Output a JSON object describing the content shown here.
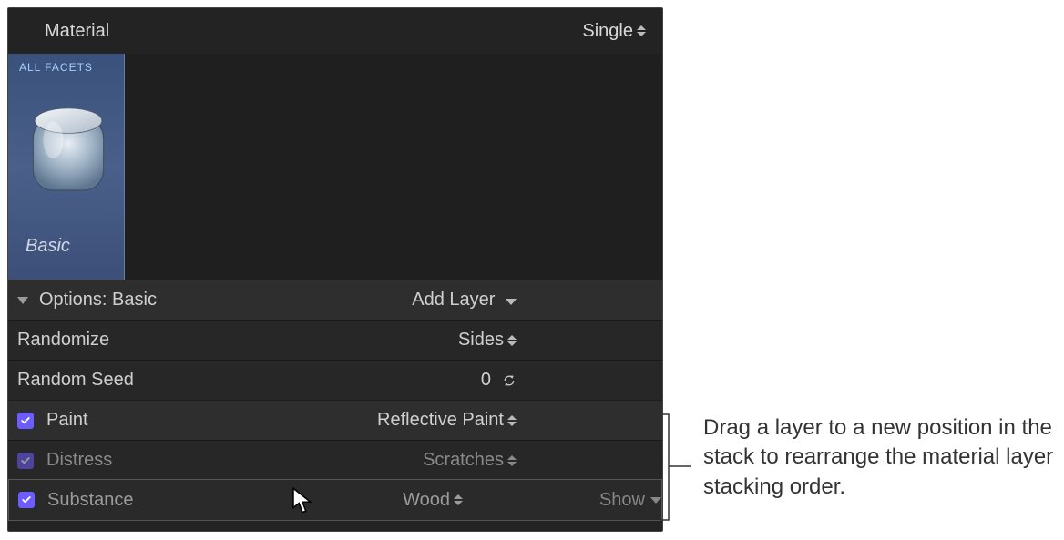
{
  "header": {
    "material_label": "Material",
    "mode_value": "Single"
  },
  "facet": {
    "tab_label": "ALL FACETS",
    "name": "Basic"
  },
  "options": {
    "title": "Options: Basic",
    "add_layer_label": "Add Layer",
    "randomize": {
      "label": "Randomize",
      "value": "Sides"
    },
    "random_seed": {
      "label": "Random Seed",
      "value": "0"
    }
  },
  "layers": [
    {
      "id": "paint",
      "label": "Paint",
      "value": "Reflective Paint",
      "checked": true
    },
    {
      "id": "distress",
      "label": "Distress",
      "value": "Scratches",
      "checked": true
    }
  ],
  "dragging_layer": {
    "id": "substance",
    "label": "Substance",
    "value": "Wood",
    "checked": true,
    "show_label": "Show"
  },
  "annotation": "Drag a layer to a new position in the stack to rearrange the material layer stacking order."
}
